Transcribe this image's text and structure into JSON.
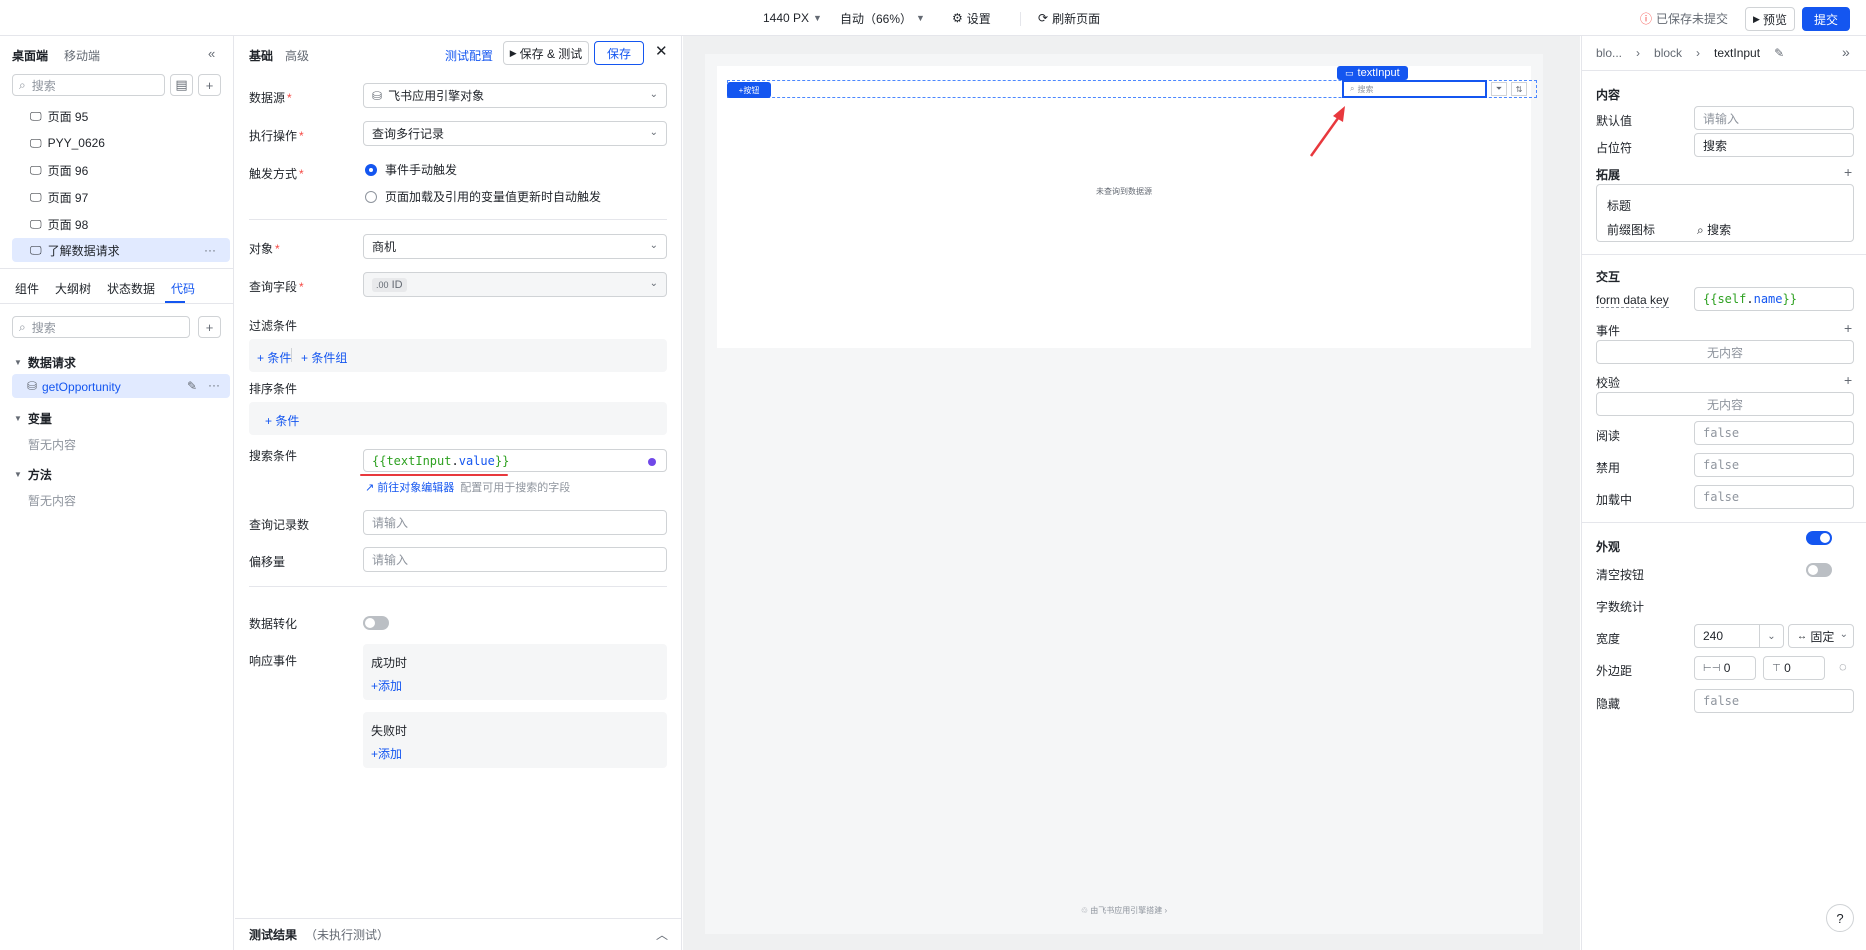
{
  "topbar": {
    "width_label": "1440 PX",
    "zoom_label": "自动（66%）",
    "settings_label": "设置",
    "refresh_label": "刷新页面",
    "unsaved_label": "已保存未提交",
    "preview_label": "预览",
    "submit_label": "提交"
  },
  "left": {
    "tabs": [
      "桌面端",
      "移动端"
    ],
    "search_placeholder": "搜索",
    "pages": [
      "页面 95",
      "PYY_0626",
      "页面 96",
      "页面 97",
      "页面 98",
      "了解数据请求"
    ],
    "bottom_tabs": [
      "组件",
      "大纲树",
      "状态数据",
      "代码"
    ],
    "code_search_placeholder": "搜索",
    "sections": {
      "requests": "数据请求",
      "request_item": "getOpportunity",
      "variables": "变量",
      "variables_empty": "暂无内容",
      "methods": "方法",
      "methods_empty": "暂无内容"
    }
  },
  "config": {
    "tabs": [
      "基础",
      "高级"
    ],
    "test_config": "测试配置",
    "save_test": "保存 & 测试",
    "save": "保存",
    "datasource_label": "数据源",
    "datasource_value": "飞书应用引擎对象",
    "action_label": "执行操作",
    "action_value": "查询多行记录",
    "trigger_label": "触发方式",
    "trigger_opt1": "事件手动触发",
    "trigger_opt2": "页面加载及引用的变量值更新时自动触发",
    "object_label": "对象",
    "object_value": "商机",
    "fields_label": "查询字段",
    "fields_tag_prefix": ".00",
    "fields_tag": "ID",
    "filter_label": "过滤条件",
    "filter_add": "条件",
    "filter_add_group": "条件组",
    "sort_label": "排序条件",
    "sort_add": "条件",
    "search_label": "搜索条件",
    "search_code_open": "{{",
    "search_code_obj": "textInput",
    "search_code_dot": ".",
    "search_code_prop": "value",
    "search_code_close": "}}",
    "goto_editor": "前往对象编辑器",
    "goto_hint": "配置可用于搜索的字段",
    "count_label": "查询记录数",
    "count_placeholder": "请输入",
    "offset_label": "偏移量",
    "offset_placeholder": "请输入",
    "transform_label": "数据转化",
    "events_label": "响应事件",
    "on_success": "成功时",
    "on_fail": "失败时",
    "add": "添加",
    "result_label": "测试结果",
    "result_status": "（未执行测试）"
  },
  "canvas": {
    "button_label": "按钮",
    "selected_tag": "textInput",
    "search_placeholder": "搜索",
    "empty_text": "未查询到数据源",
    "footer": "由飞书应用引擎搭建"
  },
  "right": {
    "breadcrumb": [
      "blo...",
      "block",
      "textInput"
    ],
    "content_title": "内容",
    "default_label": "默认值",
    "default_placeholder": "请输入",
    "placeholder_label": "占位符",
    "placeholder_value": "搜索",
    "extend_title": "拓展",
    "title_label": "标题",
    "prefix_icon_label": "前缀图标",
    "prefix_icon_value": "搜索",
    "interact_title": "交互",
    "form_key_label": "form data key",
    "form_key_open": "{{ ",
    "form_key_self": "self",
    "form_key_dot": ".",
    "form_key_name": "name",
    "form_key_close": " }}",
    "events_label": "事件",
    "events_empty": "无内容",
    "validate_label": "校验",
    "validate_empty": "无内容",
    "readonly_label": "阅读",
    "readonly_value": "false",
    "disabled_label": "禁用",
    "disabled_value": "false",
    "loading_label": "加载中",
    "loading_value": "false",
    "appearance_title": "外观",
    "clear_label": "清空按钮",
    "count_label": "字数统计",
    "width_label": "宽度",
    "width_value": "240",
    "width_mode": "固定",
    "margin_label": "外边距",
    "margin_x": "0",
    "margin_y": "0",
    "hidden_label": "隐藏",
    "hidden_value": "false"
  },
  "colors": {
    "accent": "#1456f0",
    "annotation": "#e8383d",
    "code_green": "#2ea121",
    "code_blue": "#1456f0"
  }
}
